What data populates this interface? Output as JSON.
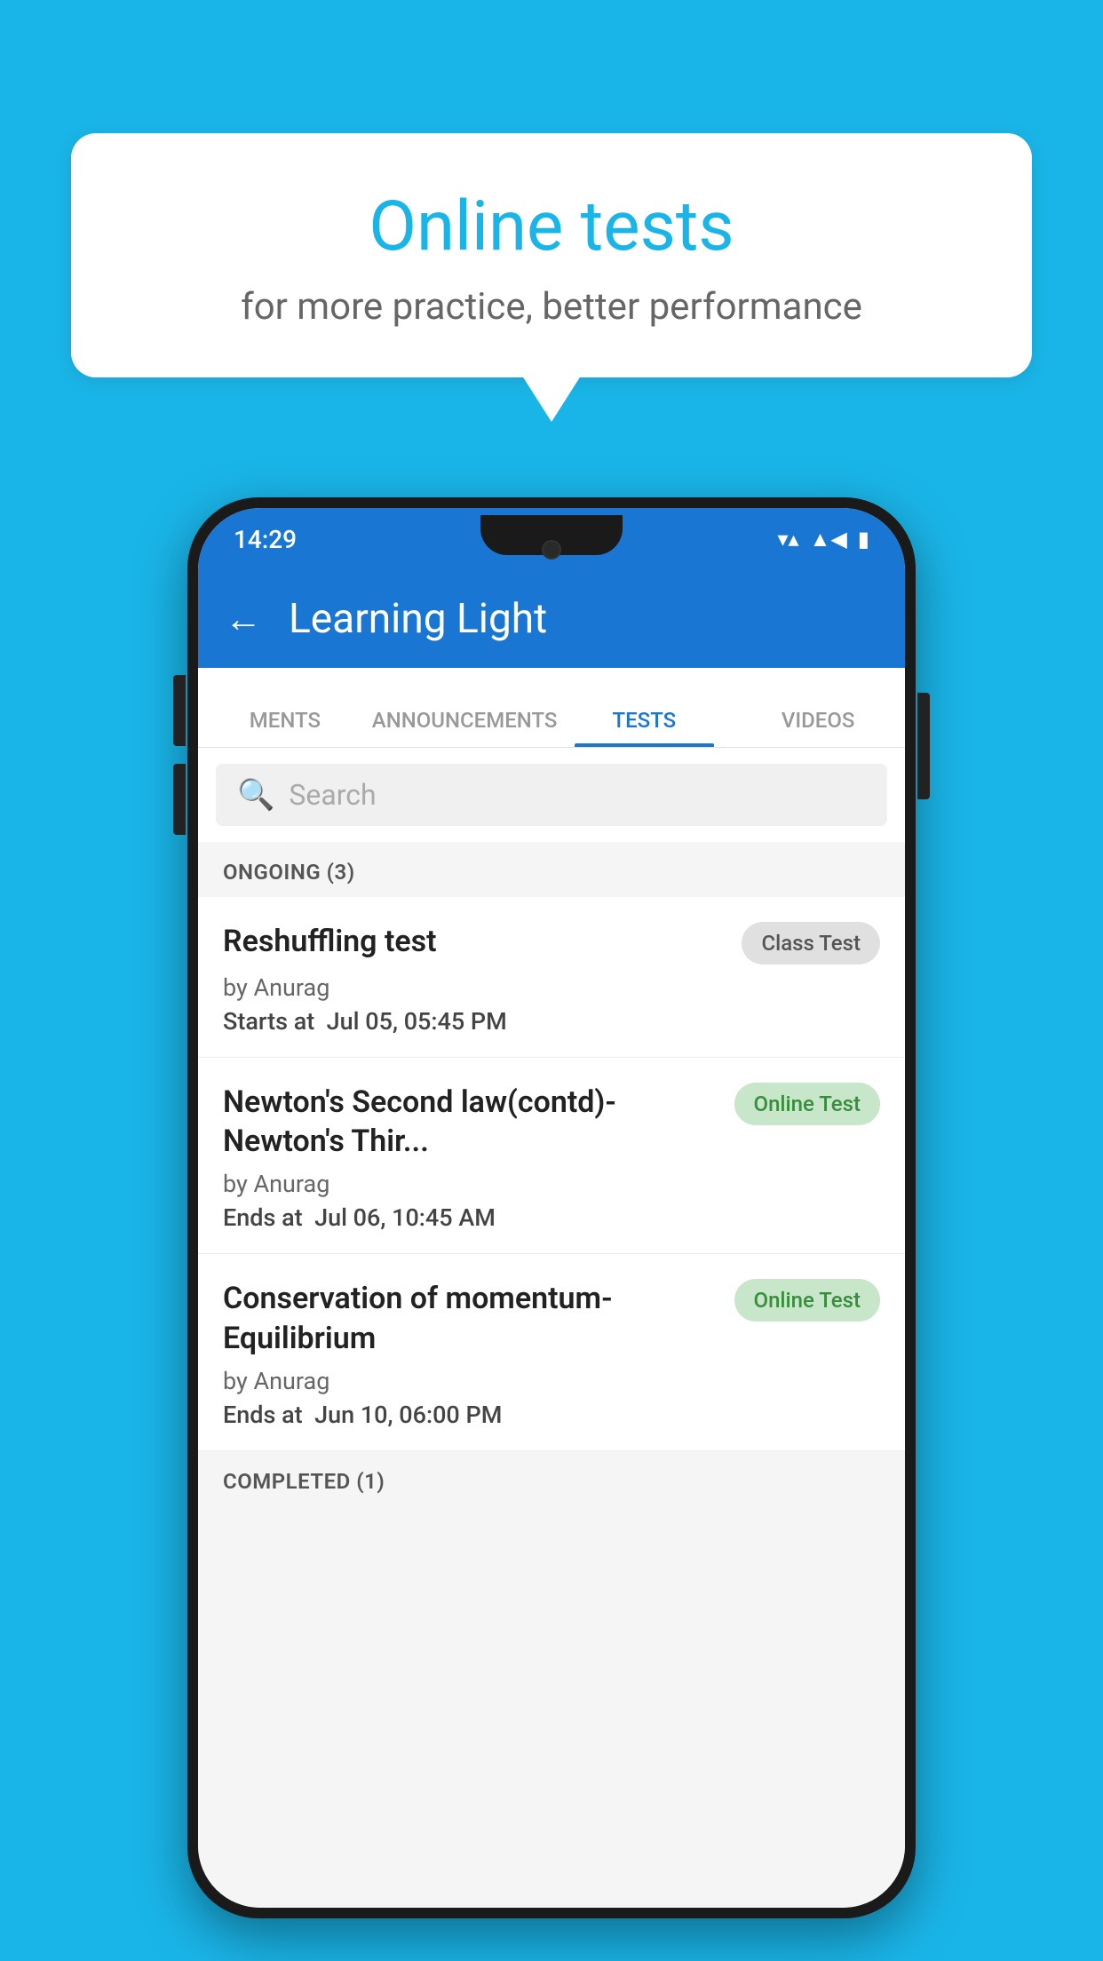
{
  "background_color": "#1ab5e8",
  "bubble": {
    "title": "Online tests",
    "subtitle": "for more practice, better performance"
  },
  "phone": {
    "status_bar": {
      "time": "14:29",
      "wifi": "▼",
      "signal": "▲",
      "battery": "▮"
    },
    "app_bar": {
      "back_label": "←",
      "title": "Learning Light"
    },
    "tabs": [
      {
        "label": "MENTS",
        "active": false
      },
      {
        "label": "ANNOUNCEMENTS",
        "active": false
      },
      {
        "label": "TESTS",
        "active": true
      },
      {
        "label": "VIDEOS",
        "active": false
      }
    ],
    "search": {
      "placeholder": "Search"
    },
    "ongoing_section": {
      "header": "ONGOING (3)",
      "items": [
        {
          "title": "Reshuffling test",
          "author": "by Anurag",
          "date_label": "Starts at",
          "date_value": "Jul 05, 05:45 PM",
          "badge": "Class Test",
          "badge_type": "class"
        },
        {
          "title": "Newton's Second law(contd)-Newton's Thir...",
          "author": "by Anurag",
          "date_label": "Ends at",
          "date_value": "Jul 06, 10:45 AM",
          "badge": "Online Test",
          "badge_type": "online"
        },
        {
          "title": "Conservation of momentum-Equilibrium",
          "author": "by Anurag",
          "date_label": "Ends at",
          "date_value": "Jun 10, 06:00 PM",
          "badge": "Online Test",
          "badge_type": "online"
        }
      ]
    },
    "completed_section": {
      "header": "COMPLETED (1)"
    }
  }
}
